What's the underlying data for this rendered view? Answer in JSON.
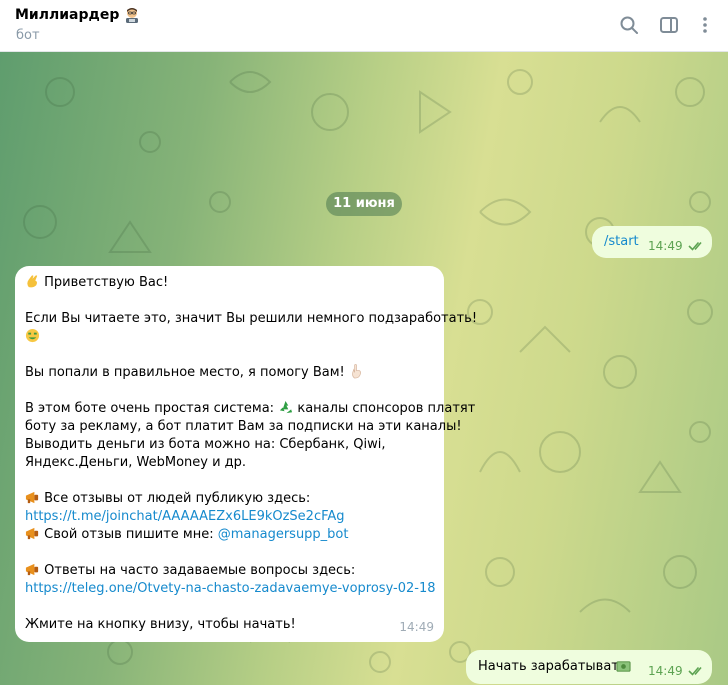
{
  "header": {
    "title": "Миллиардер",
    "subtitle": "бот"
  },
  "chat": {
    "date_label": "11 июня",
    "outgoing": [
      {
        "text": "/start",
        "time": "14:49"
      },
      {
        "text": "Начать зарабатывать",
        "time": "14:49"
      }
    ],
    "incoming": {
      "time": "14:49",
      "greeting": "Приветствую Вас!",
      "p1_line1": "Если Вы читаете это, значит Вы решили немного подзаработать!",
      "p2": "Вы попали в правильное место, я помогу Вам!",
      "p3_line1_a": "В этом боте очень простая система:",
      "p3_line1_b": "каналы спонсоров платят",
      "p3_line2": "боту за рекламу, а бот платит Вам за подписки на эти каналы!",
      "p3_line3": "Выводить деньги из бота можно на: Сбербанк, Qiwi,",
      "p3_line4": "Яндекс.Деньги, WebMoney и др.",
      "reviews_label": "Все отзывы от людей публикую здесь:",
      "reviews_link": "https://t.me/joinchat/AAAAAEZx6LE9kOzSe2cFAg",
      "own_review_label": "Свой отзыв пишите мне:",
      "own_review_handle": "@managersupp_bot",
      "faq_label": "Ответы на часто задаваемые вопросы здесь:",
      "faq_link": "https://teleg.one/Otvety-na-chasto-zadavaemye-voprosy-02-18",
      "closing": "Жмите на кнопку внизу, чтобы начать!"
    }
  },
  "colors": {
    "link": "#168acd",
    "outgoing_bubble": "#effdde",
    "check": "#5da352"
  },
  "icons": [
    "man-technologist-emoji-icon",
    "search-icon",
    "sidebar-toggle-icon",
    "more-vertical-icon",
    "double-check-icon",
    "waving-hand-emoji-icon",
    "money-mouth-emoji-icon",
    "pointing-hand-emoji-icon",
    "recycle-emoji-icon",
    "megaphone-emoji-icon",
    "money-emoji-icon"
  ]
}
